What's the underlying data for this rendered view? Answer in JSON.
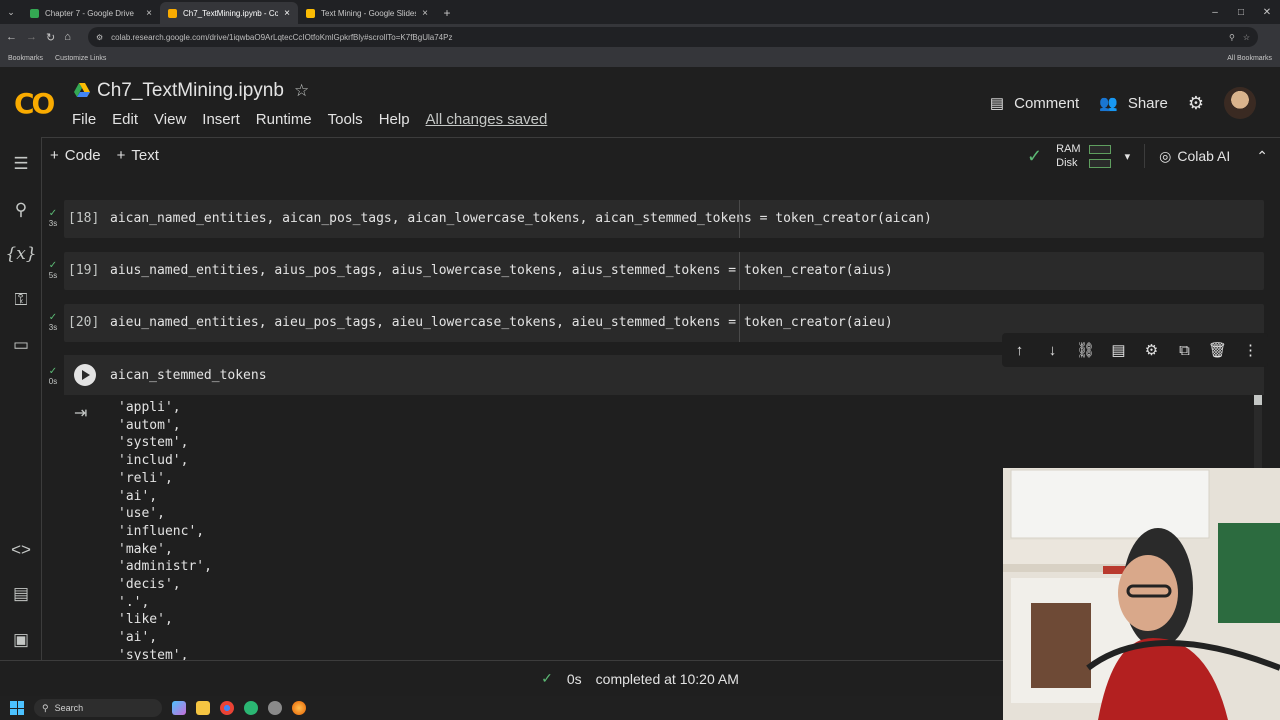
{
  "browser": {
    "tabs": [
      {
        "title": "Chapter 7 - Google Drive",
        "color": "#34a853",
        "active": false
      },
      {
        "title": "Ch7_TextMining.ipynb - Colab",
        "color": "#f9ab00",
        "active": true
      },
      {
        "title": "Text Mining - Google Slides",
        "color": "#fbbc04",
        "active": false
      }
    ],
    "new_tab": "+",
    "url": "colab.research.google.com/drive/1iqwbaO9ArLqtecCcIOtfoKmlGpkrfBly#scrollTo=K7fBgUla74Pz",
    "bookmarks": {
      "left1": "Bookmarks",
      "left2": "Customize Links",
      "right": "All Bookmarks"
    }
  },
  "colab": {
    "logo": "CO",
    "notebook_title": "Ch7_TextMining.ipynb",
    "menu": [
      "File",
      "Edit",
      "View",
      "Insert",
      "Runtime",
      "Tools",
      "Help"
    ],
    "saved_status": "All changes saved",
    "comment_label": "Comment",
    "share_label": "Share",
    "toolbar": {
      "code_label": "Code",
      "text_label": "Text",
      "ram": "RAM",
      "disk": "Disk",
      "colab_ai": "Colab AI"
    }
  },
  "cells": [
    {
      "num": "[18]",
      "time": "3s",
      "code": "aican_named_entities, aican_pos_tags, aican_lowercase_tokens, aican_stemmed_tokens = token_creator(aican)"
    },
    {
      "num": "[19]",
      "time": "5s",
      "code": "aius_named_entities, aius_pos_tags, aius_lowercase_tokens, aius_stemmed_tokens = token_creator(aius)"
    },
    {
      "num": "[20]",
      "time": "3s",
      "code": "aieu_named_entities, aieu_pos_tags, aieu_lowercase_tokens, aieu_stemmed_tokens = token_creator(aieu)"
    }
  ],
  "active_cell": {
    "time": "0s",
    "code": "aican_stemmed_tokens"
  },
  "output_lines": [
    "'appli',",
    "'autom',",
    "'system',",
    "'includ',",
    "'reli',",
    "'ai',",
    "'use',",
    "'influenc',",
    "'make',",
    "'administr',",
    "'decis',",
    "'.',",
    "'like',",
    "'ai',",
    "'system',"
  ],
  "statusbar": {
    "time": "0s",
    "completed": "completed at 10:20 AM"
  },
  "taskbar": {
    "search": "Search"
  }
}
